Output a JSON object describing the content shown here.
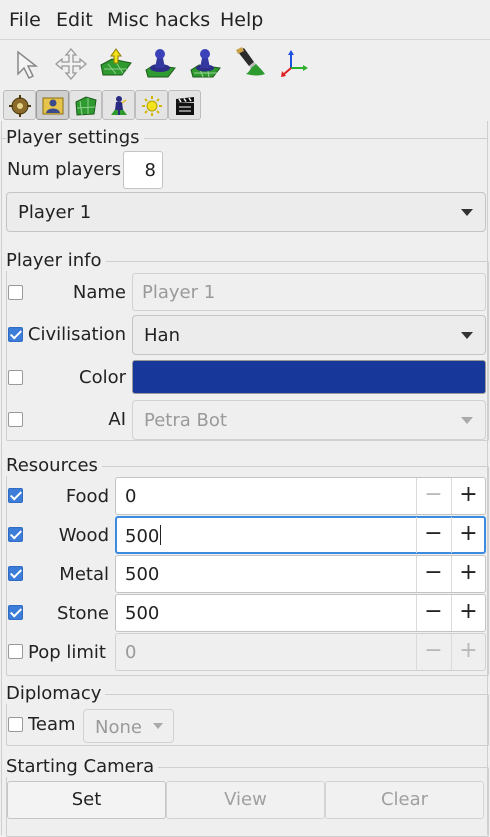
{
  "menu": {
    "file": "File",
    "edit": "Edit",
    "misc": "Misc hacks",
    "help": "Help"
  },
  "toolbar": {
    "icons": [
      "select-arrow-icon",
      "move-icon",
      "terrain-raise-icon",
      "player-pawn-icon",
      "player-pawn-grid-icon",
      "paint-brush-icon",
      "axis-transform-icon"
    ]
  },
  "tabs": [
    "map-settings",
    "player-settings",
    "terrain",
    "object",
    "environment",
    "cinematics"
  ],
  "player_settings": {
    "title": "Player settings",
    "num_players_label": "Num players",
    "num_players_value": "8",
    "selected_player": "Player 1"
  },
  "player_info": {
    "title": "Player info",
    "name_label": "Name",
    "name_placeholder": "Player 1",
    "civ_label": "Civilisation",
    "civ_value": "Han",
    "color_label": "Color",
    "color_value": "#17379a",
    "ai_label": "AI",
    "ai_value": "Petra Bot"
  },
  "resources": {
    "title": "Resources",
    "food_label": "Food",
    "food_value": "0",
    "wood_label": "Wood",
    "wood_value": "500",
    "metal_label": "Metal",
    "metal_value": "500",
    "stone_label": "Stone",
    "stone_value": "500",
    "pop_label": "Pop limit",
    "pop_value": "0",
    "minus": "−",
    "plus": "+"
  },
  "diplomacy": {
    "title": "Diplomacy",
    "team_label": "Team",
    "team_value": "None"
  },
  "camera": {
    "title": "Starting Camera",
    "set": "Set",
    "view": "View",
    "clear": "Clear"
  },
  "colors": {
    "accent": "#3b7dd8",
    "player_color": "#17379a",
    "focus": "#3b8ce0"
  }
}
